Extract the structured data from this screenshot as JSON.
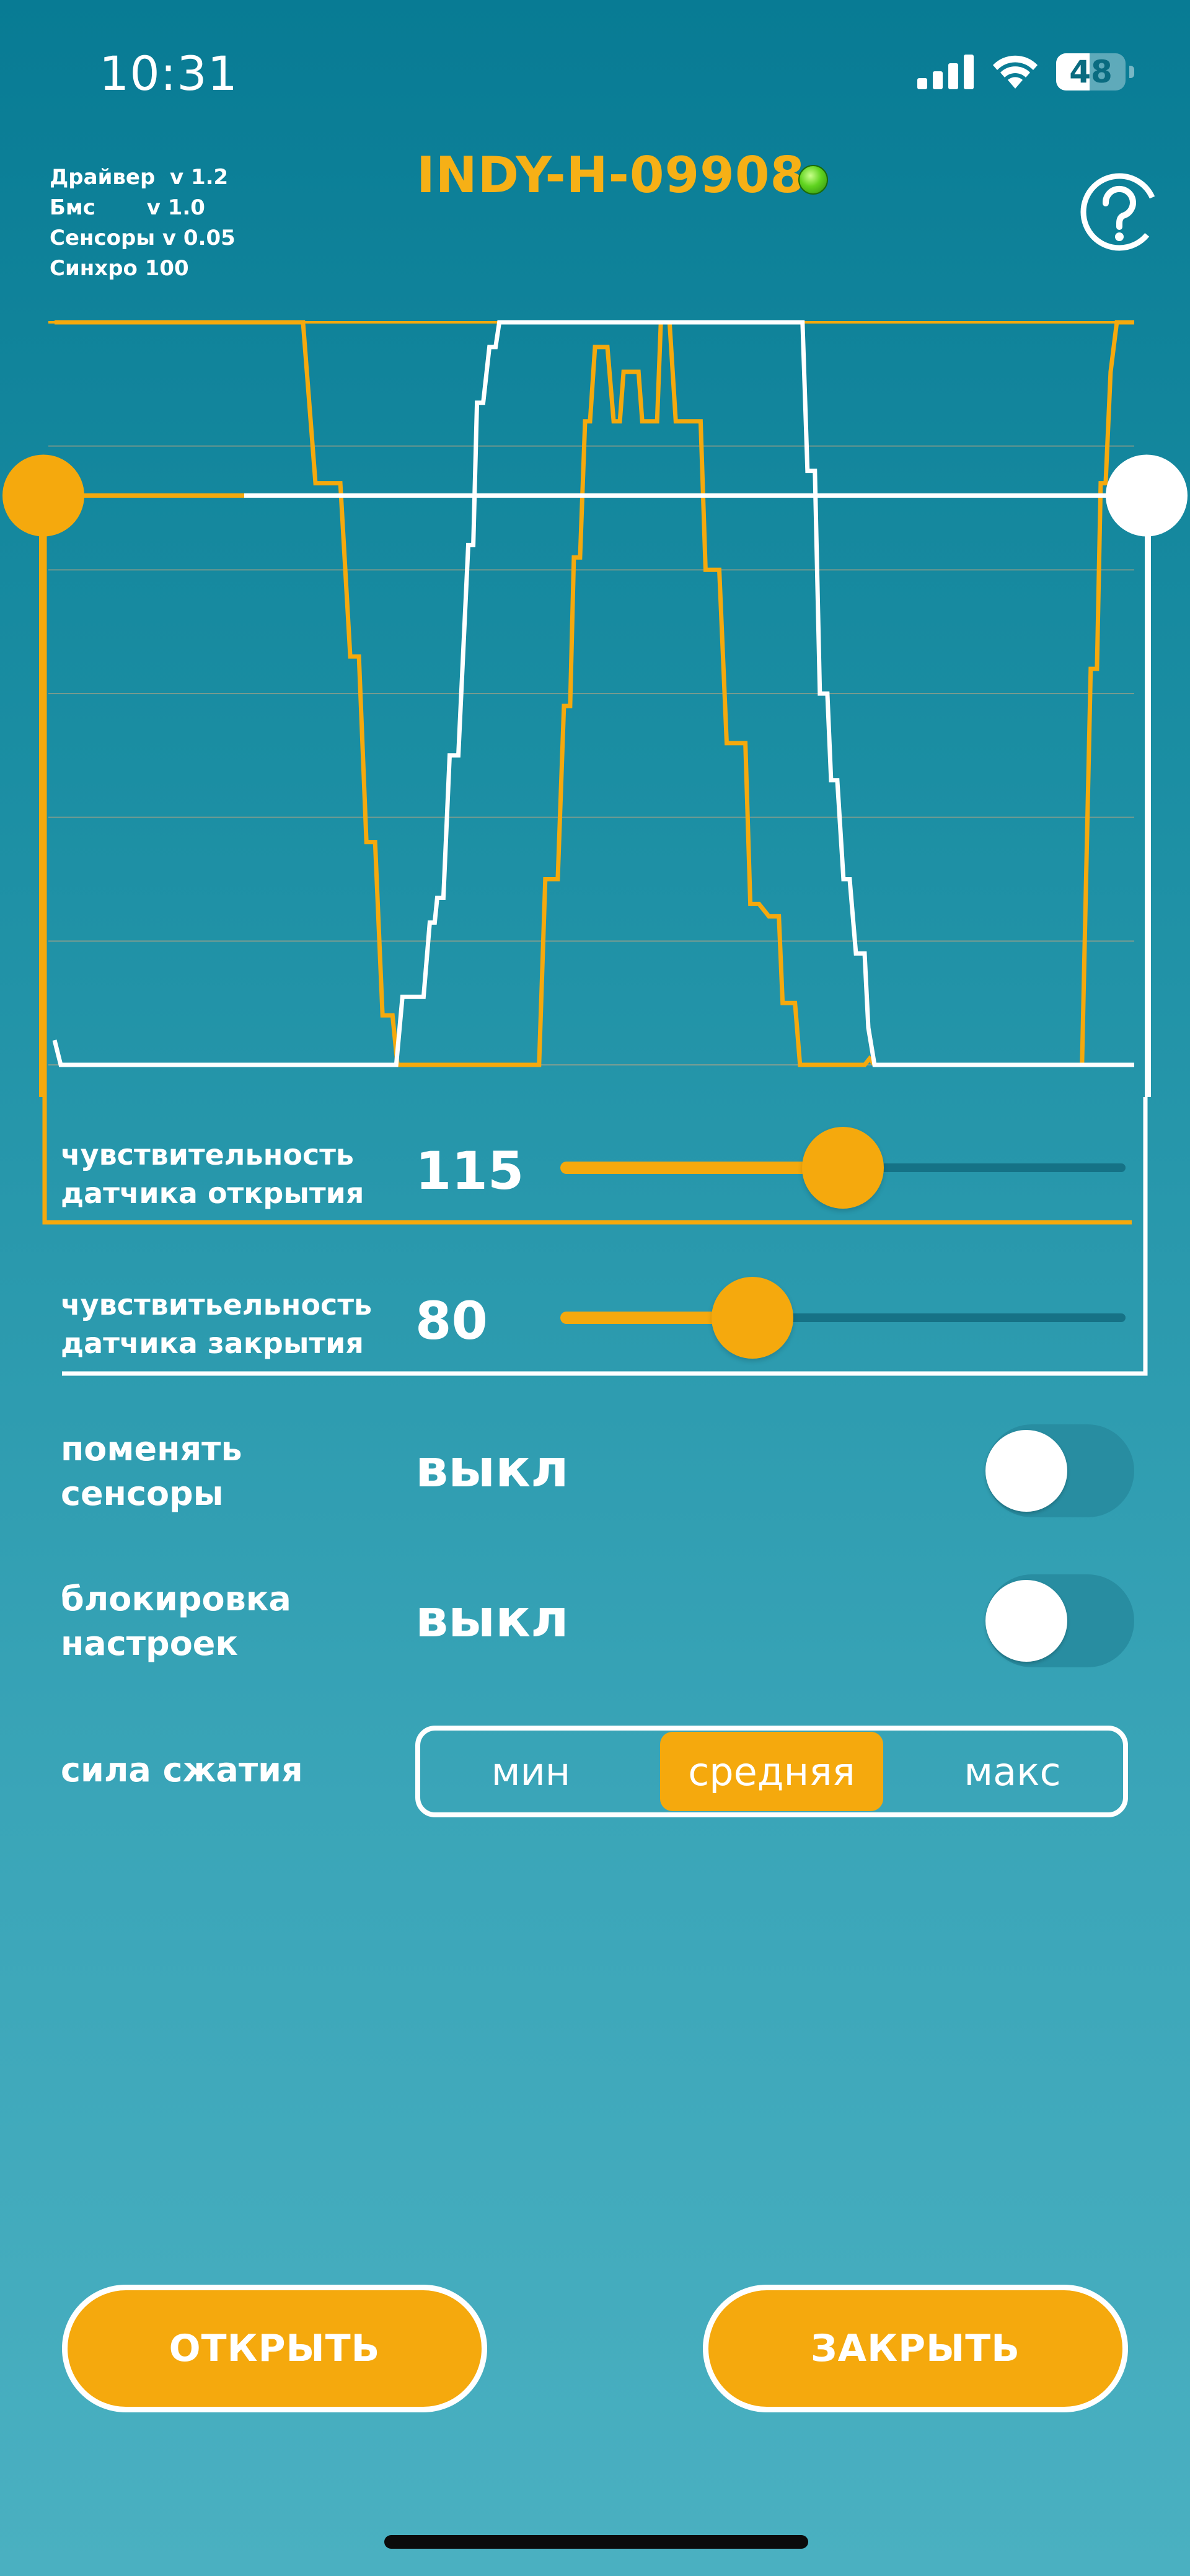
{
  "status_bar": {
    "time": "10:31",
    "battery": "48"
  },
  "header": {
    "versions": [
      "Драйвер  v 1.2",
      "Бмс       v 1.0",
      "Сенсоры v 0.05",
      "Синхро 100"
    ],
    "device_name": "INDY-H-09908",
    "connected": true
  },
  "colors": {
    "accent": "#f5a90d",
    "title": "#f6b016",
    "line_white": "#ffffff"
  },
  "chart_data": {
    "type": "line",
    "y_range": [
      0,
      6
    ],
    "grid": "horizontal",
    "series": [
      {
        "color": "#f5a90d",
        "points": [
          [
            0,
            6
          ],
          [
            200,
            6
          ],
          [
            210,
            4.7
          ],
          [
            230,
            4.7
          ],
          [
            238,
            3.3
          ],
          [
            245,
            3.3
          ],
          [
            251,
            1.8
          ],
          [
            258,
            1.8
          ],
          [
            264,
            0.4
          ],
          [
            272,
            0.4
          ],
          [
            276,
            0
          ],
          [
            390,
            0
          ],
          [
            395,
            1.5
          ],
          [
            405,
            1.5
          ],
          [
            410,
            2.9
          ],
          [
            415,
            2.9
          ],
          [
            418,
            4.1
          ],
          [
            423,
            4.1
          ],
          [
            427,
            5.2
          ],
          [
            431,
            5.2
          ],
          [
            435,
            5.8
          ],
          [
            445,
            5.8
          ],
          [
            450,
            5.2
          ],
          [
            455,
            5.2
          ],
          [
            458,
            5.6
          ],
          [
            470,
            5.6
          ],
          [
            473,
            5.2
          ],
          [
            485,
            5.2
          ],
          [
            488,
            6
          ],
          [
            495,
            6
          ],
          [
            500,
            5.2
          ],
          [
            520,
            5.2
          ],
          [
            524,
            4.0
          ],
          [
            535,
            4.0
          ],
          [
            541,
            2.6
          ],
          [
            556,
            2.6
          ],
          [
            560,
            1.3
          ],
          [
            567,
            1.3
          ],
          [
            575,
            1.2
          ],
          [
            583,
            1.2
          ],
          [
            586,
            0.5
          ],
          [
            596,
            0.5
          ],
          [
            600,
            0
          ],
          [
            652,
            0
          ],
          [
            656,
            0.05
          ],
          [
            660,
            0
          ],
          [
            827,
            0
          ],
          [
            834,
            3.2
          ],
          [
            839,
            3.2
          ],
          [
            842,
            4.7
          ],
          [
            846,
            4.7
          ],
          [
            850,
            5.6
          ],
          [
            855,
            6
          ],
          [
            869,
            6
          ]
        ]
      },
      {
        "color": "#ffffff",
        "points": [
          [
            0,
            0.2
          ],
          [
            5,
            0
          ],
          [
            275,
            0
          ],
          [
            280,
            0.55
          ],
          [
            297,
            0.55
          ],
          [
            302,
            1.15
          ],
          [
            306,
            1.15
          ],
          [
            308,
            1.35
          ],
          [
            313,
            1.35
          ],
          [
            318,
            2.5
          ],
          [
            325,
            2.5
          ],
          [
            333,
            4.2
          ],
          [
            337,
            4.2
          ],
          [
            340,
            5.35
          ],
          [
            345,
            5.35
          ],
          [
            350,
            5.8
          ],
          [
            355,
            5.8
          ],
          [
            358,
            6
          ],
          [
            600,
            6
          ],
          [
            602,
            6
          ],
          [
            606,
            4.8
          ],
          [
            612,
            4.8
          ],
          [
            616,
            3.0
          ],
          [
            622,
            3.0
          ],
          [
            625,
            2.3
          ],
          [
            630,
            2.3
          ],
          [
            635,
            1.5
          ],
          [
            640,
            1.5
          ],
          [
            645,
            0.9
          ],
          [
            652,
            0.9
          ],
          [
            655,
            0.3
          ],
          [
            660,
            0
          ],
          [
            869,
            0
          ]
        ]
      }
    ]
  },
  "chart_controls": {
    "open_marker_level": 4.6,
    "close_marker_level": 4.6
  },
  "settings": {
    "open_sensitivity": {
      "label_line1": "чувствительность",
      "label_line2": "датчика открытия",
      "value": "115",
      "fraction": 0.5
    },
    "close_sensitivity": {
      "label_line1": "чувствитьельность",
      "label_line2": "датчика закрытия",
      "value": "80",
      "fraction": 0.34
    },
    "swap_sensors": {
      "label_line1": "поменять",
      "label_line2": "сенсоры",
      "value": "выкл",
      "on": false
    },
    "lock_settings": {
      "label_line1": "блокировка",
      "label_line2": "настроек",
      "value": "выкл",
      "on": false
    },
    "grip_force": {
      "label": "сила сжатия",
      "options": [
        "мин",
        "средняя",
        "макс"
      ],
      "selected": 1
    }
  },
  "buttons": {
    "open": "ОТКРЫТЬ",
    "close": "ЗАКРЫТЬ"
  }
}
